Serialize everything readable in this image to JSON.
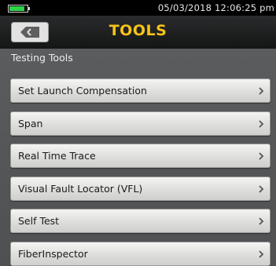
{
  "status_bar": {
    "datetime": "05/03/2018 12:06:25 pm",
    "battery_level": 0.85,
    "battery_color": "#33d14a"
  },
  "header": {
    "back_icon": "back-arrow-icon",
    "title": "TOOLS",
    "title_color": "#f7c21a"
  },
  "section": {
    "title": "Testing Tools"
  },
  "menu": {
    "chevron_icon": "chevron-right-icon",
    "items": [
      {
        "label": "Set Launch Compensation"
      },
      {
        "label": "Span"
      },
      {
        "label": "Real Time Trace"
      },
      {
        "label": "Visual Fault Locator (VFL)"
      },
      {
        "label": "Self Test"
      },
      {
        "label": "FiberInspector"
      }
    ]
  }
}
